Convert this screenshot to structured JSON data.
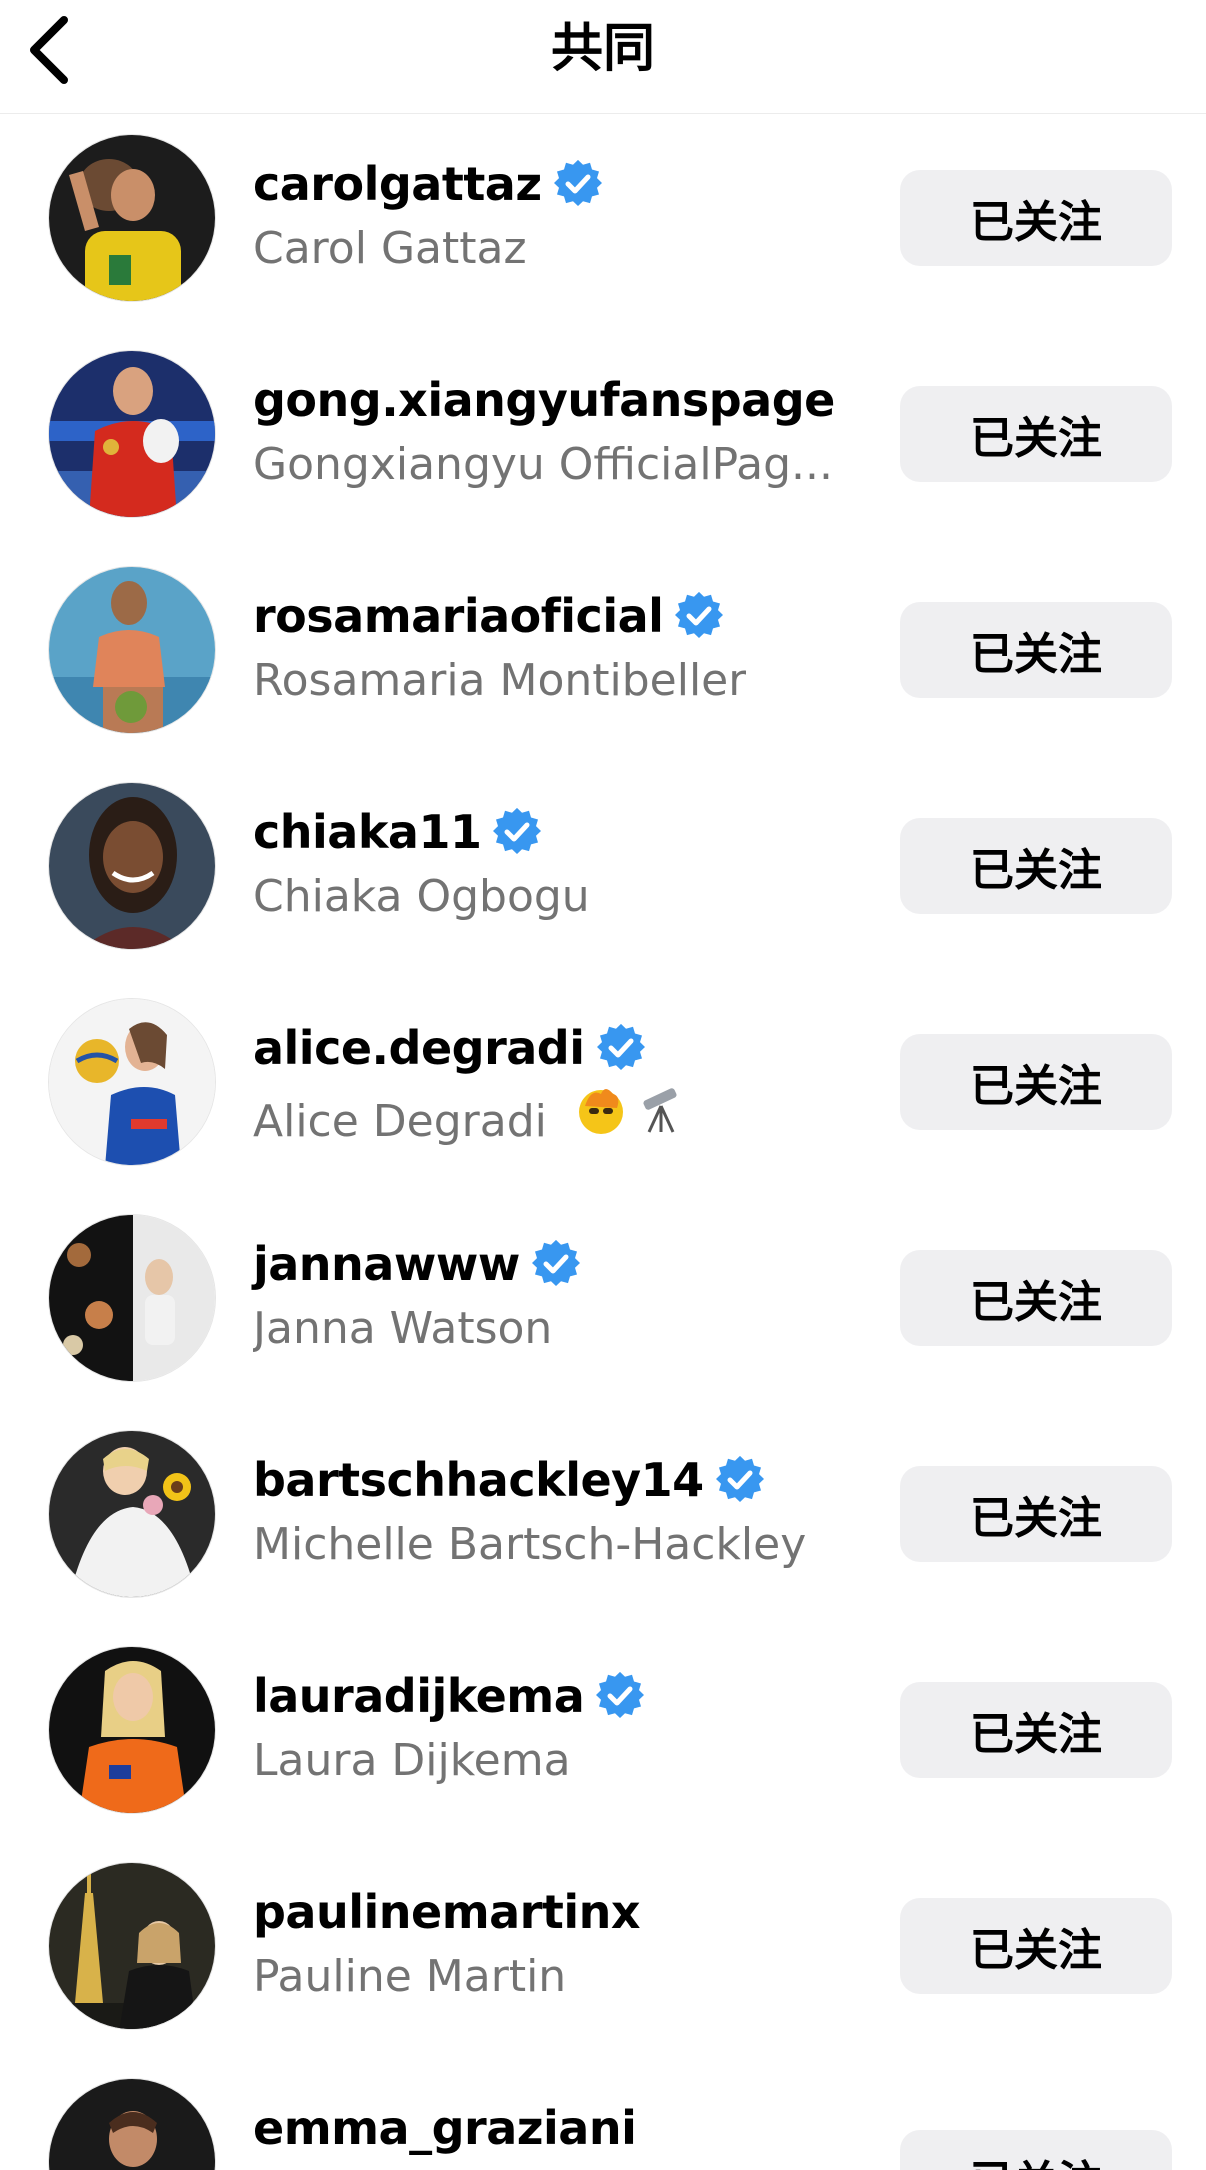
{
  "header": {
    "title": "共同",
    "back_icon": "chevron-left-icon"
  },
  "colors": {
    "verified_blue": "#3897f0",
    "button_bg": "#efeff1",
    "secondary_text": "#737373"
  },
  "users": [
    {
      "username": "carolgattaz",
      "full_name": "Carol Gattaz",
      "verified": true,
      "button": "已关注"
    },
    {
      "username": "gong.xiangyufanspage",
      "full_name": "Gongxiangyu OfficialPag...",
      "verified": false,
      "button": "已关注"
    },
    {
      "username": "rosamariaoficial",
      "full_name": "Rosamaria Montibeller",
      "verified": true,
      "button": "已关注"
    },
    {
      "username": "chiaka11",
      "full_name": "Chiaka Ogbogu",
      "verified": true,
      "button": "已关注"
    },
    {
      "username": "alice.degradi",
      "full_name": "Alice Degradi",
      "verified": true,
      "button": "已关注",
      "extra_icons": [
        "fire-face-emoji-icon",
        "telescope-emoji-icon"
      ]
    },
    {
      "username": "jannawww",
      "full_name": "Janna Watson",
      "verified": true,
      "button": "已关注"
    },
    {
      "username": "bartschhackley14",
      "full_name": "Michelle Bartsch-Hackley",
      "verified": true,
      "button": "已关注"
    },
    {
      "username": "lauradijkema",
      "full_name": "Laura Dijkema",
      "verified": true,
      "button": "已关注"
    },
    {
      "username": "paulinemartinx",
      "full_name": "Pauline Martin",
      "verified": false,
      "button": "已关注"
    },
    {
      "username": "emma_graziani",
      "full_name": "",
      "verified": false,
      "button": "已关注"
    }
  ]
}
